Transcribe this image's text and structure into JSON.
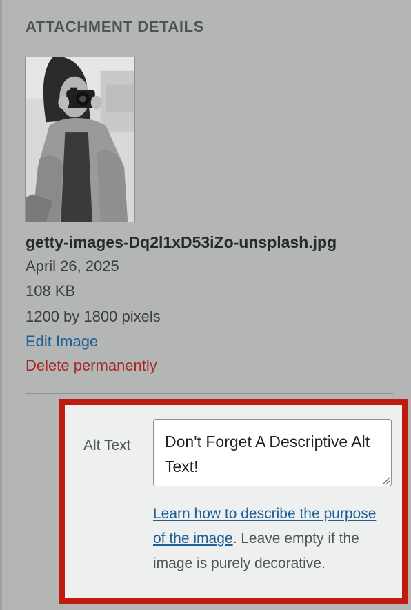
{
  "section_title": "ATTACHMENT DETAILS",
  "thumbnail": {
    "icon": "photo-woman-with-camera"
  },
  "file": {
    "name": "getty-images-Dq2l1xD53iZo-unsplash.jpg",
    "date": "April 26, 2025",
    "size": "108 KB",
    "dimensions": "1200 by 1800 pixels"
  },
  "actions": {
    "edit_label": "Edit Image",
    "delete_label": "Delete permanently"
  },
  "alt_text": {
    "label": "Alt Text",
    "value": "Don't Forget A Descriptive Alt Text!",
    "help_link": "Learn how to describe the purpose of the image",
    "help_rest": ". Leave empty if the image is purely decorative."
  },
  "colors": {
    "background": "#b4b5b5",
    "link": "#1e5f96",
    "delete": "#a52929",
    "highlight": "#c11b10"
  }
}
